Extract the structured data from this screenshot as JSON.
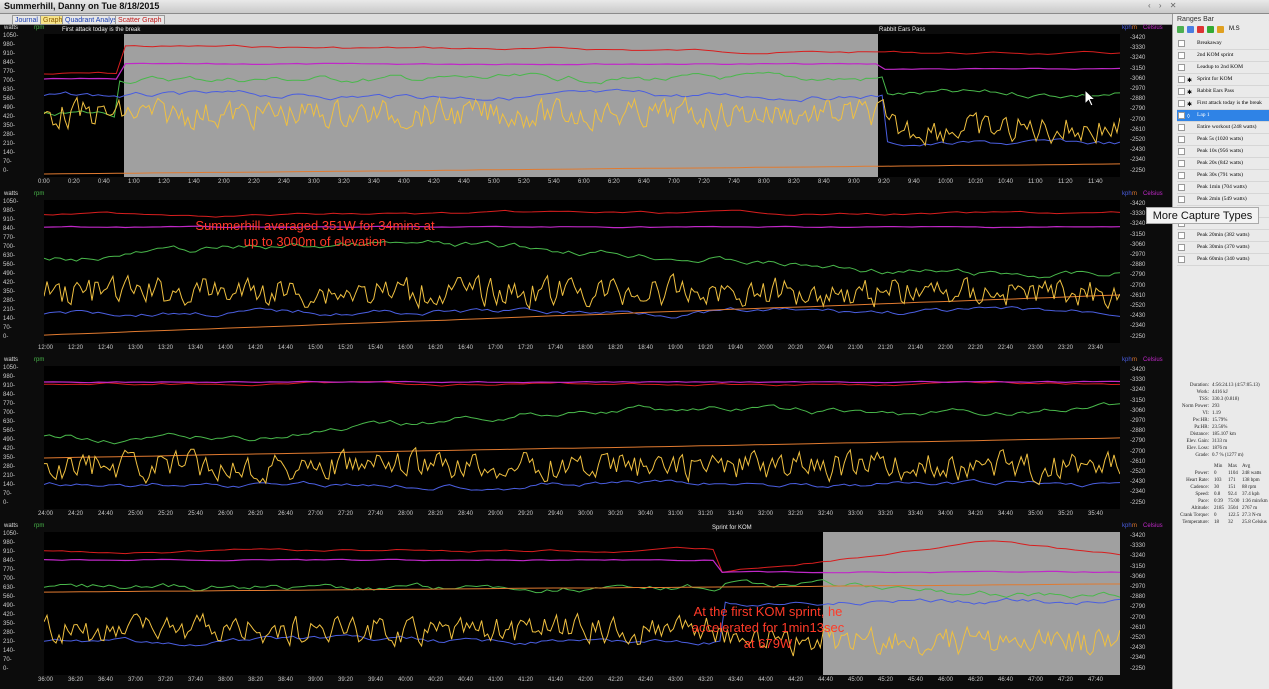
{
  "window": {
    "title": "Summerhill, Danny on Tue 8/18/2015",
    "nav": "‹ › ✕"
  },
  "tabs": [
    {
      "label": "Journal",
      "color": "#1a3fb5"
    },
    {
      "label": "Graph",
      "color": "#8a5a00",
      "active": true
    },
    {
      "label": "Quadrant Analysis",
      "color": "#1a3fb5"
    },
    {
      "label": "Scatter Graph",
      "color": "#c01818"
    }
  ],
  "axes": {
    "left_unit": "watts",
    "left_unit2": "rpm",
    "right_unit": "kph",
    "right_unit2": "m",
    "right_unit3": "Celsius",
    "watts_ticks": [
      "1050-",
      "980-",
      "910-",
      "840-",
      "770-",
      "700-",
      "630-",
      "560-",
      "490-",
      "420-",
      "350-",
      "280-",
      "210-",
      "140-",
      "70-",
      "0-"
    ],
    "elev_ticks": [
      "-3420",
      "-3330",
      "-3240",
      "-3150",
      "-3060",
      "-2970",
      "-2880",
      "-2790",
      "-2700",
      "-2610",
      "-2520",
      "-2430",
      "-2340",
      "-2250"
    ]
  },
  "panels": [
    {
      "times": [
        "0:00",
        "0:20",
        "0:40",
        "1:00",
        "1:20",
        "1:40",
        "2:00",
        "2:20",
        "2:40",
        "3:00",
        "3:20",
        "3:40",
        "4:00",
        "4:20",
        "4:40",
        "5:00",
        "5:20",
        "5:40",
        "6:00",
        "6:20",
        "6:40",
        "7:00",
        "7:20",
        "7:40",
        "8:00",
        "8:20",
        "8:40",
        "9:00",
        "9:20",
        "9:40",
        "10:00",
        "10:20",
        "10:40",
        "11:00",
        "11:20",
        "11:40"
      ],
      "ranges": [
        {
          "label": "First attack today is the break"
        },
        {
          "label": "Rabbit Ears Pass"
        }
      ]
    },
    {
      "times": [
        "12:00",
        "12:20",
        "12:40",
        "13:00",
        "13:20",
        "13:40",
        "14:00",
        "14:20",
        "14:40",
        "15:00",
        "15:20",
        "15:40",
        "16:00",
        "16:20",
        "16:40",
        "17:00",
        "17:20",
        "17:40",
        "18:00",
        "18:20",
        "18:40",
        "19:00",
        "19:20",
        "19:40",
        "20:00",
        "20:20",
        "20:40",
        "21:00",
        "21:20",
        "21:40",
        "22:00",
        "22:20",
        "22:40",
        "23:00",
        "23:20",
        "23:40"
      ],
      "annotation": "Summerhill averaged 351W for 34mins at up to 3000m of elevation"
    },
    {
      "times": [
        "24:00",
        "24:20",
        "24:40",
        "25:00",
        "25:20",
        "25:40",
        "26:00",
        "26:20",
        "26:40",
        "27:00",
        "27:20",
        "27:40",
        "28:00",
        "28:20",
        "28:40",
        "29:00",
        "29:20",
        "29:40",
        "30:00",
        "30:20",
        "30:40",
        "31:00",
        "31:20",
        "31:40",
        "32:00",
        "32:20",
        "32:40",
        "33:00",
        "33:20",
        "33:40",
        "34:00",
        "34:20",
        "34:40",
        "35:00",
        "35:20",
        "35:40"
      ]
    },
    {
      "times": [
        "36:00",
        "36:20",
        "36:40",
        "37:00",
        "37:20",
        "37:40",
        "38:00",
        "38:20",
        "38:40",
        "39:00",
        "39:20",
        "39:40",
        "40:00",
        "40:20",
        "40:40",
        "41:00",
        "41:20",
        "41:40",
        "42:00",
        "42:20",
        "42:40",
        "43:00",
        "43:20",
        "43:40",
        "44:00",
        "44:20",
        "44:40",
        "45:00",
        "45:20",
        "45:40",
        "46:00",
        "46:20",
        "46:40",
        "47:00",
        "47:20",
        "47:40"
      ],
      "ranges": [
        {
          "label": "Sprint for KOM"
        }
      ],
      "annotation": "At the first KOM sprint, he accelerated for 1min13sec at 679W"
    }
  ],
  "sidebar": {
    "header": "Ranges Bar",
    "toolbar_label": "M.S",
    "items": [
      {
        "label": "Breakaway",
        "icon": ""
      },
      {
        "label": "2nd KOM sprint",
        "icon": ""
      },
      {
        "label": "Leadup to 2nd KOM",
        "icon": ""
      },
      {
        "label": "Sprint for KOM",
        "icon": "✱"
      },
      {
        "label": "Rabbit Ears Pass",
        "icon": "✱"
      },
      {
        "label": "First attack today is the break",
        "icon": "✱"
      },
      {
        "label": "Lap 1",
        "icon": "◊",
        "selected": true
      },
      {
        "label": "Entire workout (248 watts)",
        "icon": ""
      },
      {
        "label": "Peak 5s (1020 watts)",
        "icon": ""
      },
      {
        "label": "Peak 10s (956 watts)",
        "icon": ""
      },
      {
        "label": "Peak 20s (842 watts)",
        "icon": ""
      },
      {
        "label": "Peak 30s (791 watts)",
        "icon": ""
      },
      {
        "label": "Peak 1min (704 watts)",
        "icon": ""
      },
      {
        "label": "Peak 2min (549 watts)",
        "icon": ""
      },
      {
        "label": "",
        "icon": ""
      },
      {
        "label": "",
        "icon": ""
      },
      {
        "label": "Peak 20min (382 watts)",
        "icon": ""
      },
      {
        "label": "Peak 30min (370 watts)",
        "icon": ""
      },
      {
        "label": "Peak 60min (340 watts)",
        "icon": ""
      }
    ],
    "tooltip": "More Capture Types",
    "stats": [
      {
        "k": "Duration:",
        "v": "4:56:24.13 (4:57:05.13)"
      },
      {
        "k": "Work:",
        "v": "4416 kJ"
      },
      {
        "k": "TSS:",
        "v": "330.3 (0.818)"
      },
      {
        "k": "Norm Power:",
        "v": "293"
      },
      {
        "k": "VI:",
        "v": "1.19"
      },
      {
        "k": "Pw:HR:",
        "v": "15.79%"
      },
      {
        "k": "Pa:HR:",
        "v": "23.56%"
      },
      {
        "k": "Distance:",
        "v": "185.107 km"
      },
      {
        "k": "Elev. Gain:",
        "v": "3133 m"
      },
      {
        "k": "Elev. Loss:",
        "v": "1876 m"
      },
      {
        "k": "Grade:",
        "v": "0.7 % (1277 m)"
      }
    ],
    "table": {
      "headers": [
        "",
        "Min",
        "Max",
        "Avg"
      ],
      "rows": [
        [
          "Power:",
          "0",
          "1104",
          "248 watts"
        ],
        [
          "Heart Rate:",
          "103",
          "171",
          "138 bpm"
        ],
        [
          "Cadence:",
          "30",
          "151",
          "88 rpm"
        ],
        [
          "Speed:",
          "0.8",
          "92.4",
          "37.4 kph"
        ],
        [
          "Pace:",
          "0:39",
          "75:00",
          "1:36 min/km"
        ],
        [
          "Altitude:",
          "2185",
          "3504",
          "2767 m"
        ],
        [
          "Crank Torque:",
          "0",
          "122.5",
          "27.3 N-m"
        ],
        [
          "Temperature:",
          "18",
          "32",
          "25.8 Celsius"
        ]
      ]
    }
  },
  "colors": {
    "power": "#f0c040",
    "heart_rate": "#d81e1e",
    "cadence": "#49b84b",
    "speed": "#4a5ee0",
    "elevation": "#e07a30",
    "temperature": "#c028c8",
    "highlight": "#a0a0a0"
  }
}
